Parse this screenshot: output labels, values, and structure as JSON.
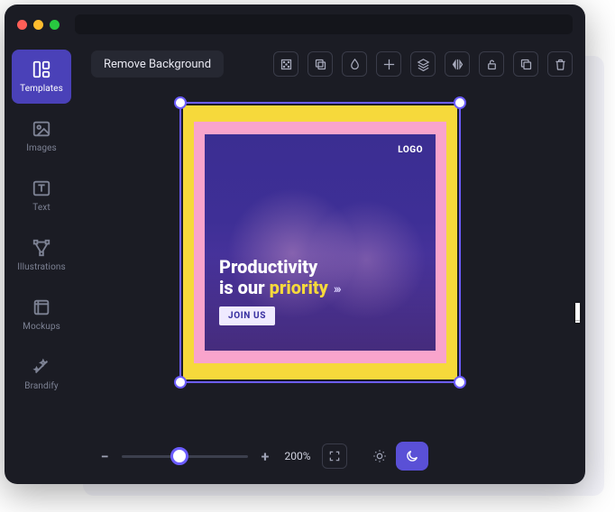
{
  "sidebar": {
    "items": [
      {
        "label": "Templates"
      },
      {
        "label": "Images"
      },
      {
        "label": "Text"
      },
      {
        "label": "Illustrations"
      },
      {
        "label": "Mockups"
      },
      {
        "label": "Brandify"
      }
    ],
    "active_index": 0
  },
  "toolbar": {
    "remove_bg_label": "Remove Background",
    "icons": [
      "distribute",
      "duplicate",
      "fill",
      "grid",
      "layers",
      "flip-h",
      "lock",
      "copy",
      "delete"
    ]
  },
  "canvas": {
    "logo_text": "LOGO",
    "headline_line1": "Productivity",
    "headline_line2_a": "is our ",
    "headline_line2_b": "priority",
    "arrows": "›››",
    "cta_label": "JOIN US",
    "colors": {
      "frame_outer": "#f6d93b",
      "frame_inner": "#f9a4cc",
      "selection": "#6b5cff",
      "accent_text": "#f6d93b"
    }
  },
  "footer": {
    "zoom_value": "200%",
    "slider_pct": 46,
    "mode_active": "dark"
  }
}
